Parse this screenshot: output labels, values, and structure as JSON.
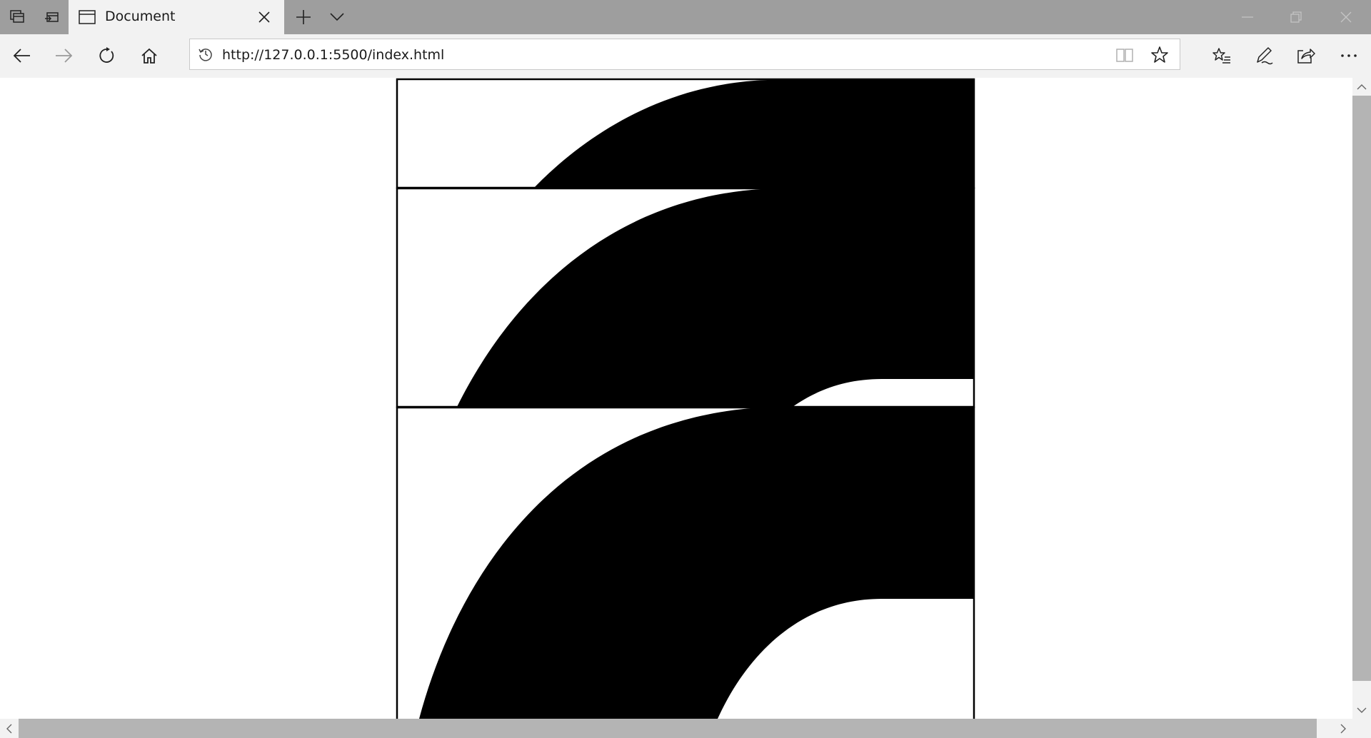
{
  "tab": {
    "title": "Document",
    "icons": [
      "tab-manager-icon",
      "set-aside-tabs-icon",
      "page-icon",
      "close-icon",
      "new-tab-icon",
      "tab-list-chevron-icon"
    ]
  },
  "window_controls": [
    "minimize-icon",
    "restore-icon",
    "window-close-icon"
  ],
  "nav": {
    "url": "http://127.0.0.1:5500/index.html",
    "icons": [
      "back-arrow-icon",
      "forward-arrow-icon",
      "refresh-icon",
      "home-icon",
      "history-icon",
      "reading-view-icon",
      "favorite-star-icon",
      "favorites-list-icon",
      "pen-icon",
      "share-icon",
      "more-icon"
    ]
  },
  "page": {
    "colors": {
      "fill": "#000000",
      "background": "#ffffff"
    }
  }
}
